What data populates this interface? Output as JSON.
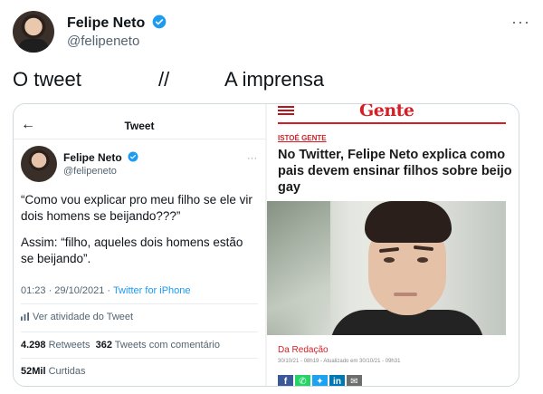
{
  "tweet": {
    "author_name": "Felipe Neto",
    "author_handle": "@felipeneto",
    "more_icon": "more-horizontal-icon",
    "text_left": "O tweet",
    "text_sep": "//",
    "text_right": "A imprensa"
  },
  "left_panel": {
    "back_icon": "back-arrow-icon",
    "title": "Tweet",
    "author_name": "Felipe Neto",
    "author_handle": "@felipeneto",
    "paragraph1": "“Como vou explicar pro meu filho se ele vir dois homens se beijando???”",
    "paragraph2": "Assim: “filho, aqueles dois homens estão se beijando”.",
    "time_date": "01:23 · 29/10/2021 · ",
    "source": "Twitter for iPhone",
    "activity_label": "Ver atividade do Tweet",
    "retweets_count": "4.298",
    "retweets_label": "Retweets",
    "quotes_count": "362",
    "quotes_label": "Tweets com comentário",
    "likes_count": "52Mil",
    "likes_label": "Curtidas"
  },
  "right_panel": {
    "brand": "Gente",
    "section": "ISTOÉ GENTE",
    "headline": "No Twitter, Felipe Neto explica como pais devem ensinar filhos sobre beijo gay",
    "byline": "Da Redação",
    "dates": "30/10/21 - 08h19 - Atualizado em 30/10/21 - 09h31",
    "share_icons": [
      "facebook-icon",
      "whatsapp-icon",
      "twitter-icon",
      "linkedin-icon",
      "email-icon"
    ]
  },
  "colors": {
    "accent_blue": "#1d9bf0",
    "brand_red": "#d41f26",
    "text_primary": "#0f1419",
    "text_secondary": "#536471"
  }
}
